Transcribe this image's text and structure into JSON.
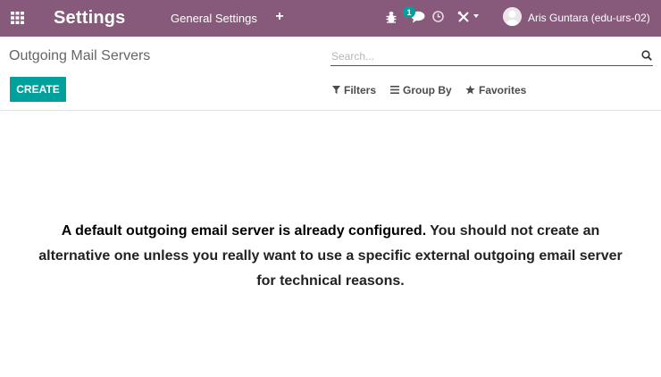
{
  "navbar": {
    "app_title": "Settings",
    "menu_general": "General Settings",
    "plus_icon": "+",
    "chat_badge": "1",
    "user_name": "Aris Guntara (edu-urs-02)",
    "background": "#875a7b"
  },
  "control_panel": {
    "breadcrumb": "Outgoing Mail Servers",
    "search_placeholder": "Search...",
    "create_label": "CREATE",
    "filters_label": "Filters",
    "groupby_label": "Group By",
    "favorites_label": "Favorites",
    "accent": "#00a09d"
  },
  "helper": {
    "title": "A default outgoing email server is already configured.",
    "body": " You should not create an alternative one unless you really want to use a specific external outgoing email server for technical reasons."
  }
}
